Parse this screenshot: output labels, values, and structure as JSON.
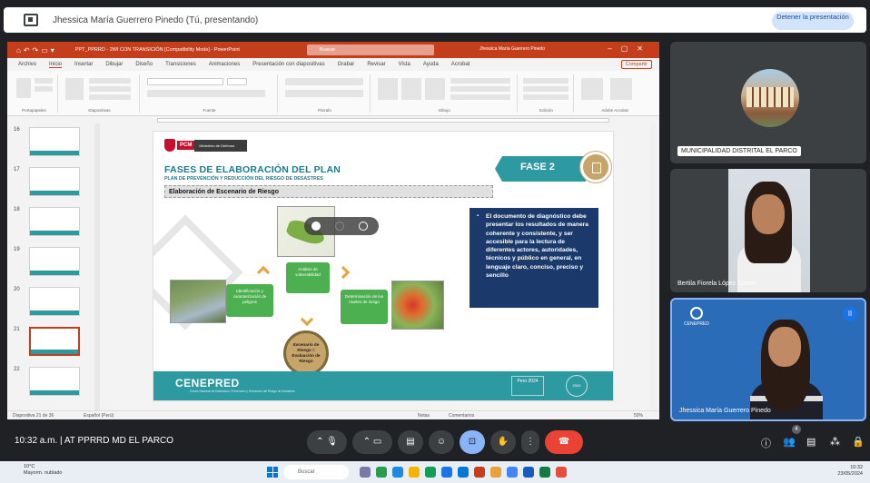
{
  "presenting_bar": {
    "title": "Jhessica María Guerrero Pinedo (Tú, presentando)",
    "stop_button": "Detener la presentación"
  },
  "ppt": {
    "doc_title": "PPT_PPRRD - 2WI CON TRANSICIÓN [Compatibility Mode] - PowerPoint",
    "search_placeholder": "Buscar",
    "user": "Jhessica María Guerrero Pinedo",
    "menu": [
      "Archivo",
      "Inicio",
      "Insertar",
      "Dibujar",
      "Diseño",
      "Transiciones",
      "Animaciones",
      "Presentación con diapositivas",
      "Grabar",
      "Revisar",
      "Vista",
      "Ayuda",
      "Acrobat"
    ],
    "share": "Compartir",
    "ribbon_groups": [
      "Portapapeles",
      "Diapositivas",
      "Fuente",
      "Párrafo",
      "Dibujo",
      "Edición",
      "Adobe Acrobat"
    ],
    "thumb_numbers": [
      "16",
      "17",
      "18",
      "19",
      "20",
      "21",
      "22"
    ],
    "status_left": "Diapositiva 21 de 36",
    "status_lang": "Español (Perú)",
    "status_notes": "Notas",
    "status_comments": "Comentarios",
    "zoom": "50%"
  },
  "slide": {
    "ministry_abbr": "PCM",
    "ministry": "Ministerio de Defensa",
    "title": "FASES DE ELABORACIÓN DEL PLAN",
    "subtitle": "PLAN DE PREVENCIÓN Y REDUCCIÓN DEL RIESGO DE DESASTRES",
    "section": "Elaboración de Escenario de Riesgo",
    "phase": "FASE 2",
    "bullet": "El documento de diagnóstico debe presentar los resultados de manera coherente y consistente, y ser accesible para la lectura de diferentes actores, autoridades, técnicos y público en general, en lenguaje claro, conciso, preciso y sencillo",
    "box_left": "Identificación y caracterización de peligros",
    "box_top": "Análisis de vulnerabilidad",
    "box_right": "Determinación de los niveles de riesgo",
    "circle": "Escenario de Riesgo = Evaluación de Riesgo",
    "footer_brand": "CENEPRED",
    "footer_sub": "Centro Nacional de Estimación, Prevención y Reducción del Riesgo de Desastres",
    "footer_logo1": "Perú 2024",
    "footer_logo2": "2024"
  },
  "participants": [
    {
      "name": "MUNICIPALIDAD DISTRITAL EL PARCO"
    },
    {
      "name": "Bertila Fiorela López Cúneo"
    },
    {
      "name": "Jhessica María Guerrero Pinedo",
      "org": "CENEPRED"
    }
  ],
  "meeting": {
    "time_title": "10:32 a.m. | AT PPRRD MD EL PARCO",
    "participant_count": "4"
  },
  "taskbar": {
    "weather_temp": "10°C",
    "weather_desc": "Mayorm. nublado",
    "search": "Buscar",
    "tray_time": "10:32",
    "tray_date": "23/05/2024"
  },
  "colors": {
    "meet_bg": "#202124",
    "ppt_accent": "#c43e1c",
    "slide_teal": "#2d9aa2",
    "slide_navy": "#1b3a6b",
    "green_box": "#4caf50",
    "end_call": "#ea4335"
  }
}
